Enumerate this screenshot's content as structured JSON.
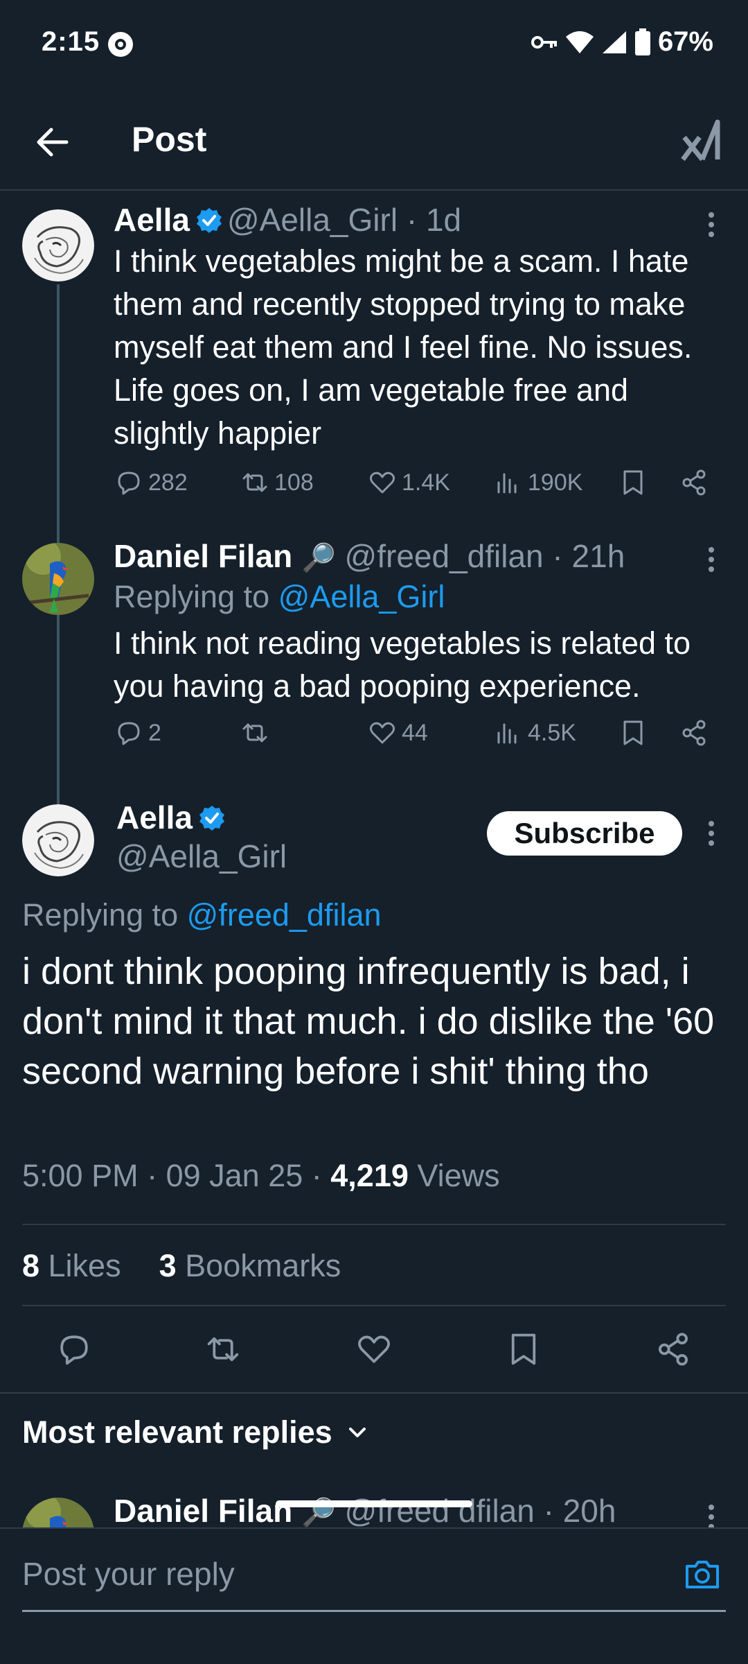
{
  "status_bar": {
    "time": "2:15",
    "battery": "67%"
  },
  "header": {
    "title": "Post"
  },
  "thread": [
    {
      "name": "Aella",
      "handle": "@Aella_Girl",
      "time": " · 1d",
      "text": "I think vegetables might be a scam. I hate them and recently stopped trying to make myself eat them and I feel fine. No issues. Life goes on, I am vegetable free and slightly happier",
      "replies": "282",
      "reposts": "108",
      "likes": "1.4K",
      "views": "190K"
    },
    {
      "name": "Daniel Filan",
      "emoji": "🔎",
      "handle": "@freed_dfilan",
      "time": " · 21h",
      "replying_label": "Replying to ",
      "replying_handle": "@Aella_Girl",
      "text": "I think not reading vegetables is related to you having a bad pooping experience.",
      "replies": "2",
      "reposts": "",
      "likes": "44",
      "views": "4.5K"
    }
  ],
  "main_tweet": {
    "name": "Aella",
    "handle": "@Aella_Girl",
    "subscribe_label": "Subscribe",
    "replying_label": "Replying to ",
    "replying_handle": "@freed_dfilan",
    "text": "i dont think pooping infrequently is bad, i don't mind it that much. i do dislike the '60 second warning before i shit' thing tho",
    "time": "5:00 PM",
    "date": "09 Jan 25",
    "views_count": "4,219",
    "views_label": " Views",
    "likes_count": "8",
    "likes_label": " Likes",
    "bookmarks_count": "3",
    "bookmarks_label": " Bookmarks"
  },
  "replies_section": {
    "title": "Most relevant replies",
    "first_reply": {
      "name": "Daniel Filan",
      "emoji": "🔎",
      "handle": "@freed dfilan",
      "time": " · 20h"
    }
  },
  "composer": {
    "placeholder": "Post your reply"
  },
  "colors": {
    "background": "#15202b",
    "accent": "#1d9bf0",
    "muted": "#8b98a5"
  }
}
